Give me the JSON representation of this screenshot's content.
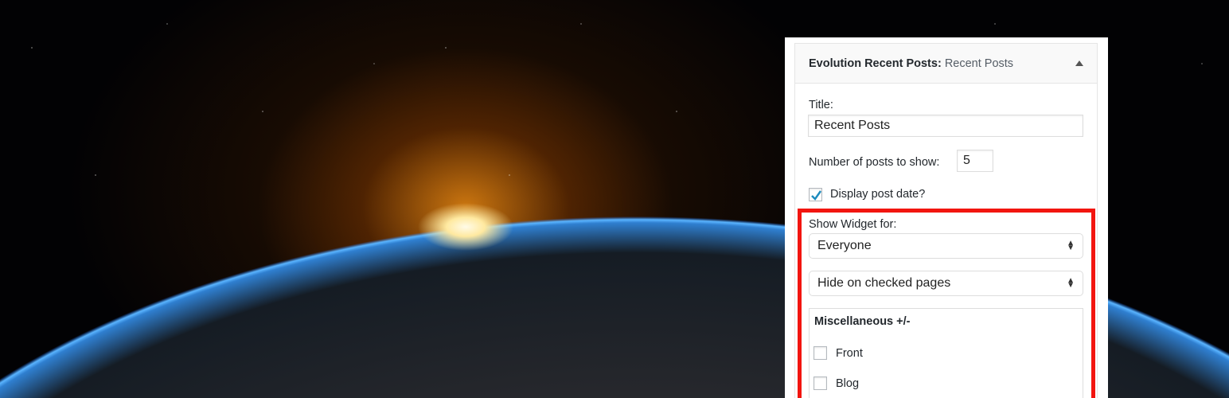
{
  "widget": {
    "title_bold": "Evolution Recent Posts:",
    "title_sub": "Recent Posts",
    "title_label": "Title:",
    "title_value": "Recent Posts",
    "number_label": "Number of posts to show:",
    "number_value": "5",
    "display_date_label": "Display post date?",
    "display_date_checked": true,
    "show_for_label": "Show Widget for:",
    "show_for_value": "Everyone",
    "visibility_value": "Hide on checked pages",
    "misc_heading": "Miscellaneous +/-",
    "pages": [
      {
        "label": "Front",
        "checked": false
      },
      {
        "label": "Blog",
        "checked": false
      }
    ]
  },
  "colors": {
    "highlight": "#f2150f",
    "check": "#1e8cbe"
  }
}
